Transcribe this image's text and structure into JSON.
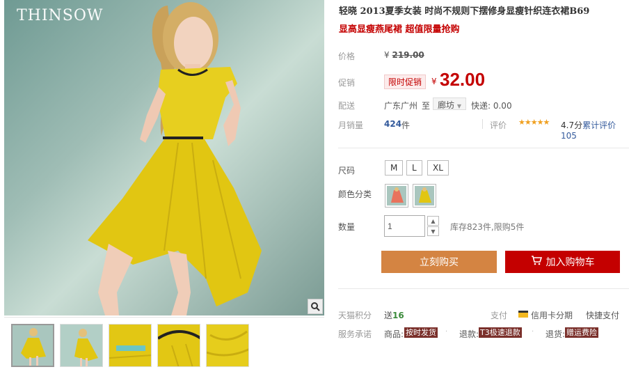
{
  "gallery": {
    "brand": "THINSOW",
    "zoom_icon": "magnifier-icon",
    "thumbnails": [
      "thumb-1",
      "thumb-2",
      "thumb-3",
      "thumb-4",
      "thumb-5"
    ]
  },
  "product": {
    "title": "轻晓 2013夏季女装 时尚不规则下摆修身显瘦针织连衣裙B69",
    "subtitle": "显高显瘦燕尾裙 超值限量抢购",
    "price_label": "价格",
    "currency": "¥",
    "original_price": "219.00",
    "promo_label": "促销",
    "promo_tag": "限时促销",
    "promo_price": "32.00",
    "shipping_label": "配送",
    "ship_from": "广东广州",
    "ship_to_word": "至",
    "ship_to_city": "廊坊",
    "express": "快递: 0.00",
    "monthly_sales_label": "月销量",
    "monthly_sales": "424",
    "sales_unit": "件",
    "rating_label": "评价",
    "stars": "★★★★★",
    "rating_score": "4.7分",
    "review_text": "累计评价105"
  },
  "options": {
    "size_label": "尺码",
    "sizes": [
      "M",
      "L",
      "XL"
    ],
    "color_label": "颜色分类",
    "quantity_label": "数量",
    "quantity_value": "1",
    "stock_text": "库存823件,限购5件"
  },
  "actions": {
    "buy_now": "立刻购买",
    "add_to_cart": "加入购物车"
  },
  "extras": {
    "points_label": "天猫积分",
    "points_prefix": "送",
    "points_value": "16",
    "payment_label": "支付",
    "credit_card": "信用卡分期",
    "quick_pay": "快捷支付",
    "service_label": "服务承诺",
    "svc1_label": "商品:",
    "svc1_badge": "按时发货",
    "svc2_label": "退款:",
    "svc2_badge": "T3极速退款",
    "svc3_label": "退货:",
    "svc3_badge": "赠运费险"
  },
  "colors": {
    "price_red": "#c40000",
    "buy_orange": "#d48442",
    "link_blue": "#335a9c",
    "dress_yellow": "#e7cf1f"
  }
}
